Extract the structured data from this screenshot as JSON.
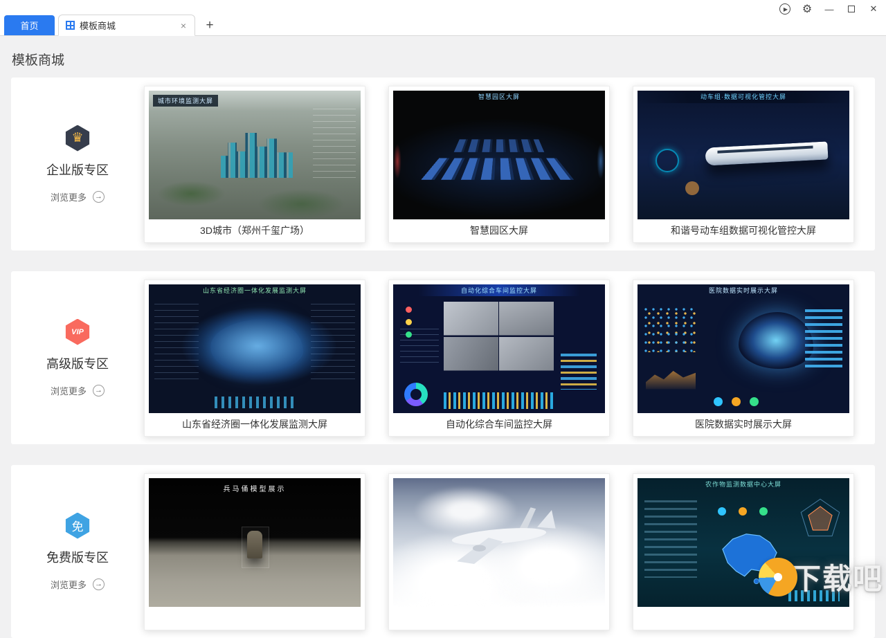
{
  "window": {
    "home_label": "首页",
    "tab_title": "模板商城",
    "tab_close": "×",
    "new_tab": "+",
    "controls": {
      "run": "▶",
      "settings": "⚙",
      "minimize": "—",
      "close": "✕"
    }
  },
  "icons": {
    "arrow_right": "→"
  },
  "page": {
    "title": "模板商城",
    "sections": [
      {
        "id": "enterprise",
        "badge_icon": "♛",
        "title": "企业版专区",
        "more_label": "浏览更多",
        "cards": [
          {
            "caption": "3D城市（郑州千玺广场）",
            "thumb_title": "城市环境监测大屏"
          },
          {
            "caption": "智慧园区大屏",
            "thumb_title": "智慧园区大屏"
          },
          {
            "caption": "和谐号动车组数据可视化管控大屏",
            "thumb_title": "动车组·数据可视化管控大屏"
          }
        ]
      },
      {
        "id": "premium",
        "badge_icon": "VIP",
        "title": "高级版专区",
        "more_label": "浏览更多",
        "cards": [
          {
            "caption": "山东省经济圈一体化发展监测大屏",
            "thumb_title": "山东省经济圈一体化发展监测大屏"
          },
          {
            "caption": "自动化综合车间监控大屏",
            "thumb_title": "自动化综合车间监控大屏"
          },
          {
            "caption": "医院数据实时展示大屏",
            "thumb_title": "医院数据实时展示大屏"
          }
        ]
      },
      {
        "id": "free",
        "badge_icon": "免",
        "title": "免费版专区",
        "more_label": "浏览更多",
        "cards": [
          {
            "caption": "",
            "thumb_title": "兵马俑模型展示"
          },
          {
            "caption": "",
            "thumb_title": ""
          },
          {
            "caption": "",
            "thumb_title": "农作物监测数据中心大屏"
          }
        ]
      }
    ]
  },
  "watermark": {
    "text": "下载吧"
  },
  "colors": {
    "accent_blue": "#2a7af0",
    "vip_red": "#f96a5e",
    "free_blue": "#3fa3e3",
    "crown_gold": "#f2b848"
  }
}
